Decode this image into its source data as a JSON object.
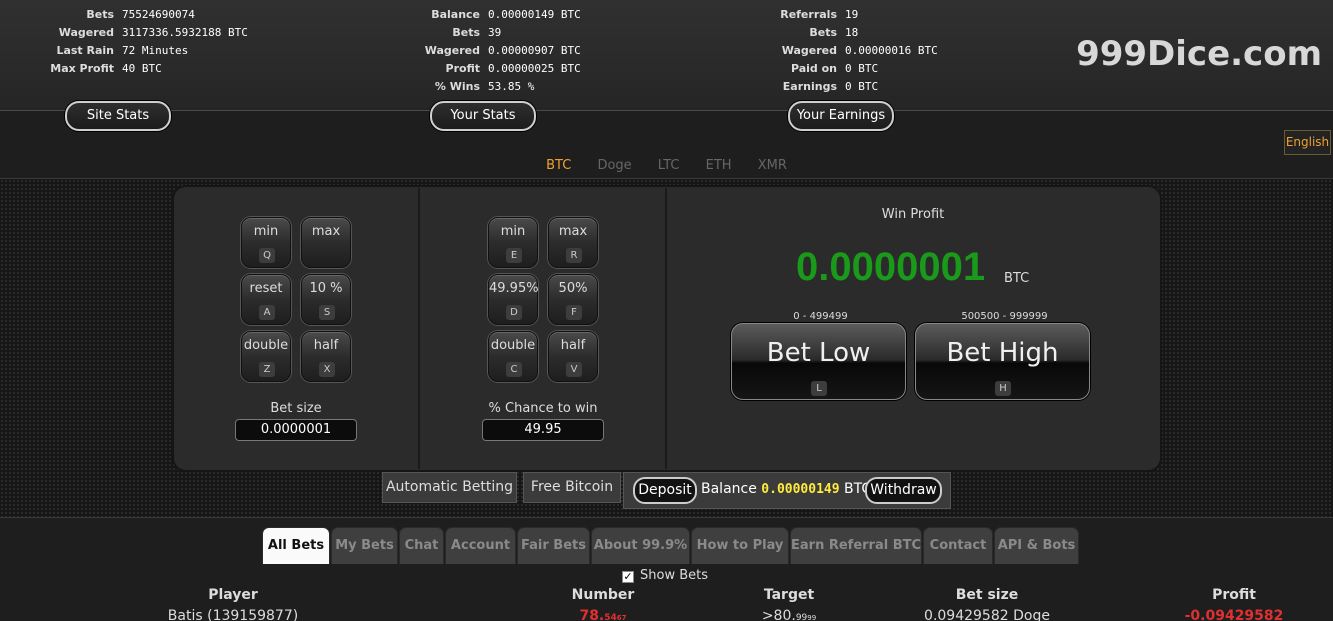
{
  "site_stats": {
    "button": "Site Stats",
    "rows": [
      {
        "label": "Bets",
        "value": "75524690074"
      },
      {
        "label": "Wagered",
        "value": "3117336.5932188 BTC"
      },
      {
        "label": "Last Rain",
        "value": "72 Minutes"
      },
      {
        "label": "Max Profit",
        "value": "40 BTC"
      }
    ]
  },
  "your_stats": {
    "button": "Your Stats",
    "rows": [
      {
        "label": "Balance",
        "value": "0.00000149 BTC"
      },
      {
        "label": "Bets",
        "value": "39"
      },
      {
        "label": "Wagered",
        "value": "0.00000907 BTC"
      },
      {
        "label": "Profit",
        "value": "0.00000025 BTC"
      },
      {
        "label": "% Wins",
        "value": "53.85 %"
      }
    ]
  },
  "your_earnings": {
    "button": "Your Earnings",
    "rows": [
      {
        "label": "Referrals",
        "value": "19"
      },
      {
        "label": "Bets",
        "value": "18"
      },
      {
        "label": "Wagered",
        "value": "0.00000016 BTC"
      },
      {
        "label": "Paid on",
        "value": "0 BTC"
      },
      {
        "label": "Earnings",
        "value": "0 BTC"
      }
    ]
  },
  "logo": "999Dice.com",
  "language": "English",
  "currencies": [
    "BTC",
    "Doge",
    "LTC",
    "ETH",
    "XMR"
  ],
  "active_currency": "BTC",
  "bet_size_panel": {
    "buttons": [
      {
        "label": "min",
        "key": "Q"
      },
      {
        "label": "max",
        "key": ""
      },
      {
        "label": "reset",
        "key": "A"
      },
      {
        "label": "10 %",
        "key": "S"
      },
      {
        "label": "double",
        "key": "Z"
      },
      {
        "label": "half",
        "key": "X"
      }
    ],
    "field_label": "Bet size",
    "value": "0.0000001"
  },
  "chance_panel": {
    "buttons": [
      {
        "label": "min",
        "key": "E"
      },
      {
        "label": "max",
        "key": "R"
      },
      {
        "label": "49.95%",
        "key": "D"
      },
      {
        "label": "50%",
        "key": "F"
      },
      {
        "label": "double",
        "key": "C"
      },
      {
        "label": "half",
        "key": "V"
      }
    ],
    "field_label": "% Chance to win",
    "value": "49.95"
  },
  "win_profit": {
    "label": "Win Profit",
    "value": "0.0000001",
    "unit": "BTC"
  },
  "bet_low": {
    "range": "0 - 499499",
    "label": "Bet Low",
    "key": "L"
  },
  "bet_high": {
    "range": "500500 - 999999",
    "label": "Bet High",
    "key": "H"
  },
  "actions": {
    "automatic_betting": "Automatic Betting",
    "free_bitcoin": "Free Bitcoin",
    "deposit": "Deposit",
    "balance_label": "Balance",
    "balance_value": "0.00000149",
    "balance_unit": "BTC",
    "withdraw": "Withdraw"
  },
  "tabs": [
    "All Bets",
    "My Bets",
    "Chat",
    "Account",
    "Fair Bets",
    "About 99.9%",
    "How to Play",
    "Earn Referral BTC",
    "Contact",
    "API & Bots"
  ],
  "show_bets": {
    "label": "Show Bets",
    "checked": "✓"
  },
  "table": {
    "headers": [
      "Player",
      "Number",
      "Target",
      "Bet size",
      "Profit"
    ],
    "rows": [
      {
        "player": "Batis (139159877)",
        "number_main": "78.",
        "number_small": "54",
        "number_tail": "67",
        "target_main": ">80.",
        "target_small": "99",
        "target_tail": "99",
        "bet_size": "0.09429582 Doge",
        "profit": "-0.09429582"
      }
    ]
  }
}
